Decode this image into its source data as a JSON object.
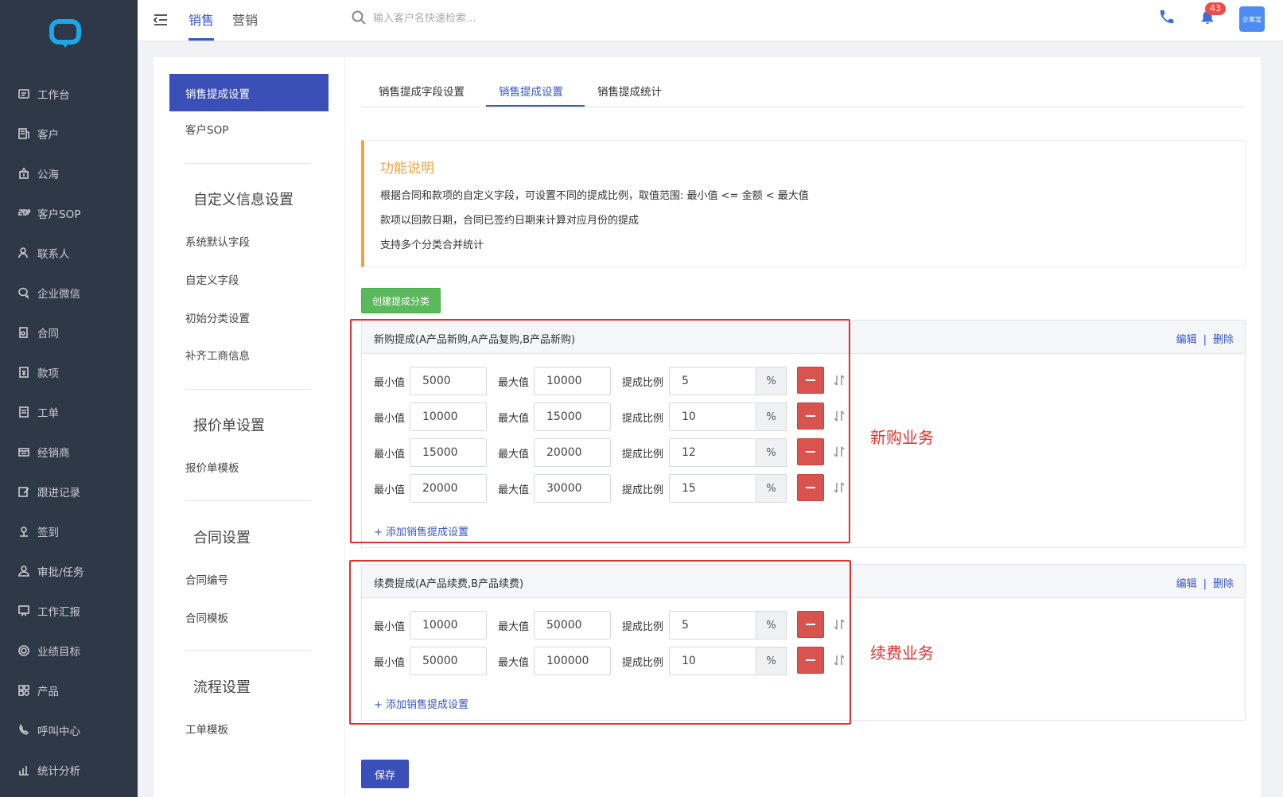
{
  "sidebar": {
    "items": [
      {
        "label": "工作台",
        "icon": "workbench-icon"
      },
      {
        "label": "客户",
        "icon": "customer-icon"
      },
      {
        "label": "公海",
        "icon": "public-pool-icon"
      },
      {
        "label": "客户SOP",
        "icon": "sop-icon"
      },
      {
        "label": "联系人",
        "icon": "contact-icon"
      },
      {
        "label": "企业微信",
        "icon": "wechat-icon"
      },
      {
        "label": "合同",
        "icon": "contract-icon"
      },
      {
        "label": "款项",
        "icon": "payment-icon"
      },
      {
        "label": "工单",
        "icon": "ticket-icon"
      },
      {
        "label": "经销商",
        "icon": "dealer-icon"
      },
      {
        "label": "跟进记录",
        "icon": "followup-icon"
      },
      {
        "label": "签到",
        "icon": "checkin-icon"
      },
      {
        "label": "审批/任务",
        "icon": "approval-icon"
      },
      {
        "label": "工作汇报",
        "icon": "report-icon"
      },
      {
        "label": "业绩目标",
        "icon": "target-icon"
      },
      {
        "label": "产品",
        "icon": "product-icon"
      },
      {
        "label": "呼叫中心",
        "icon": "callcenter-icon"
      },
      {
        "label": "统计分析",
        "icon": "statistics-icon"
      }
    ]
  },
  "header": {
    "tabs": [
      "销售",
      "营销"
    ],
    "search_placeholder": "输入客户名快速检索...",
    "notification_count": "43",
    "avatar_text": "企客宝"
  },
  "subnav": {
    "active": "销售提成设置",
    "sop": "客户SOP",
    "groups": [
      {
        "title": "自定义信息设置",
        "items": [
          "系统默认字段",
          "自定义字段",
          "初始分类设置",
          "补齐工商信息"
        ]
      },
      {
        "title": "报价单设置",
        "items": [
          "报价单模板"
        ]
      },
      {
        "title": "合同设置",
        "items": [
          "合同编号",
          "合同模板"
        ]
      },
      {
        "title": "流程设置",
        "items": [
          "工单模板"
        ]
      }
    ]
  },
  "main": {
    "tabs": [
      "销售提成字段设置",
      "销售提成设置",
      "销售提成统计"
    ],
    "info": {
      "title": "功能说明",
      "lines": [
        "根据合同和款项的自定义字段，可设置不同的提成比例，取值范围: 最小值 <= 金额 < 最大值",
        "款项以回款日期，合同已签约日期来计算对应月份的提成",
        "支持多个分类合并统计"
      ]
    },
    "create_button": "创建提成分类",
    "labels": {
      "min": "最小值",
      "max": "最大值",
      "ratio": "提成比例",
      "percent": "%"
    },
    "edit": "编辑",
    "delete": "删除",
    "separator": "|",
    "add_link": "+ 添加销售提成设置",
    "categories": [
      {
        "title": "新购提成(A产品新购,A产品复购,B产品新购)",
        "annotation": "新购业务",
        "rows": [
          {
            "min": "5000",
            "max": "10000",
            "ratio": "5"
          },
          {
            "min": "10000",
            "max": "15000",
            "ratio": "10"
          },
          {
            "min": "15000",
            "max": "20000",
            "ratio": "12"
          },
          {
            "min": "20000",
            "max": "30000",
            "ratio": "15"
          }
        ]
      },
      {
        "title": "续费提成(A产品续费,B产品续费)",
        "annotation": "续费业务",
        "rows": [
          {
            "min": "10000",
            "max": "50000",
            "ratio": "5"
          },
          {
            "min": "50000",
            "max": "100000",
            "ratio": "10"
          }
        ]
      }
    ],
    "save_button": "保存"
  }
}
